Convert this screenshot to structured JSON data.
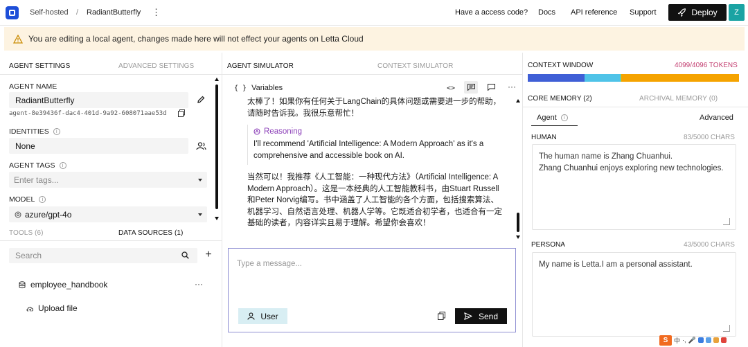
{
  "topbar": {
    "breadcrumb_root": "Self-hosted",
    "breadcrumb_sep": "/",
    "agent_name": "RadiantButterfly",
    "links": [
      "Have a access code?",
      "Docs",
      "API reference",
      "Support"
    ],
    "deploy_label": "Deploy",
    "avatar_initial": "Z"
  },
  "banner": {
    "text": "You are editing a local agent, changes made here will not effect your agents on Letta Cloud"
  },
  "left": {
    "tabs": [
      "AGENT SETTINGS",
      "ADVANCED SETTINGS"
    ],
    "agent_name_label": "AGENT NAME",
    "agent_name_value": "RadiantButterfly",
    "agent_id": "agent-8e39436f-dac4-401d-9a92-608071aae53d",
    "identities_label": "IDENTITIES",
    "identities_value": "None",
    "agent_tags_label": "AGENT TAGS",
    "tags_placeholder": "Enter tags...",
    "model_label": "MODEL",
    "model_value": "azure/gpt-4o",
    "source_tabs": [
      "TOOLS (6)",
      "DATA SOURCES (1)"
    ],
    "search_placeholder": "Search",
    "data_source_name": "employee_handbook",
    "upload_label": "Upload file"
  },
  "middle": {
    "tabs": [
      "AGENT SIMULATOR",
      "CONTEXT SIMULATOR"
    ],
    "variables_label": "Variables",
    "message_top": "太棒了！如果你有任何关于LangChain的具体问题或需要进一步的帮助，请随时告诉我。我很乐意帮忙！",
    "reasoning_title": "Reasoning",
    "reasoning_text": "I'll recommend 'Artificial Intelligence: A Modern Approach' as it's a comprehensive and accessible book on AI.",
    "message_bottom": "当然可以！我推荐《人工智能：一种现代方法》（Artificial Intelligence: A Modern Approach）。这是一本经典的人工智能教科书，由Stuart Russell和Peter Norvig编写。书中涵盖了人工智能的各个方面，包括搜索算法、机器学习、自然语言处理、机器人学等。它既适合初学者，也适合有一定基础的读者，内容详实且易于理解。希望你会喜欢！",
    "composer_placeholder": "Type a message...",
    "user_label": "User",
    "send_label": "Send"
  },
  "right": {
    "context_title": "CONTEXT WINDOW",
    "tokens": "4099/4096 TOKENS",
    "token_segments": [
      {
        "color": "#3f5fd6",
        "fraction": 0.27
      },
      {
        "color": "#4fc3e8",
        "fraction": 0.17
      },
      {
        "color": "#9fd84f",
        "fraction": 0.004
      },
      {
        "color": "#f5a300",
        "fraction": 0.556
      }
    ],
    "memory_tabs": [
      "CORE MEMORY (2)",
      "ARCHIVAL MEMORY (0)"
    ],
    "subtabs": [
      "Agent",
      "Advanced"
    ],
    "human_label": "HUMAN",
    "human_chars": "83/5000 CHARS",
    "human_text_1": "The human name is Zhang Chuanhui.",
    "human_text_2": "Zhang Chuanhui enjoys exploring new technologies.",
    "persona_label": "PERSONA",
    "persona_chars": "43/5000 CHARS",
    "persona_text": "My name is Letta.I am a personal assistant."
  },
  "tray": {
    "ime_label": "S",
    "lang": "中"
  }
}
